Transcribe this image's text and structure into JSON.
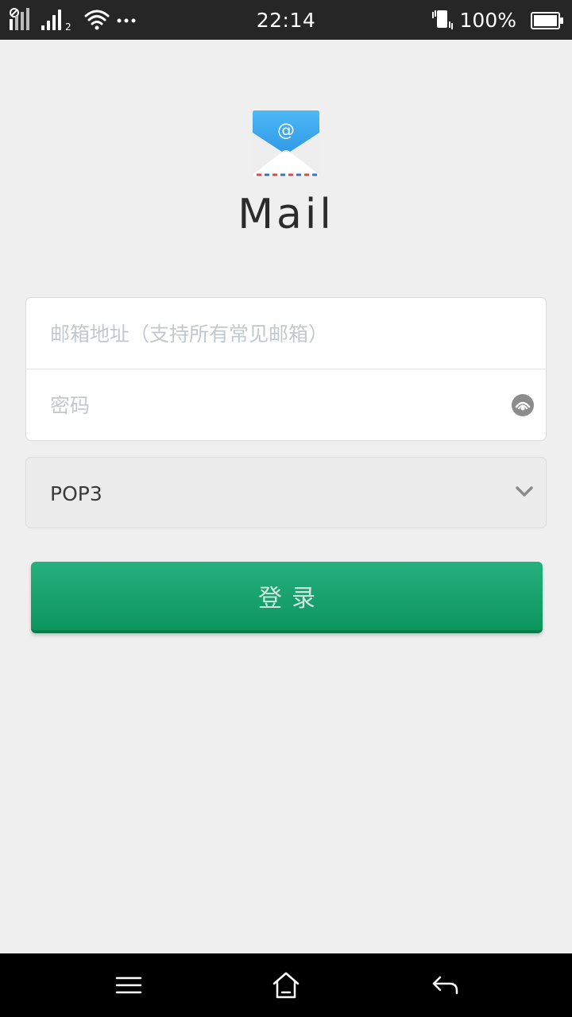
{
  "status_bar": {
    "time": "22:14",
    "battery_percent": "100%",
    "left_icons": [
      "sim1-signal-icon",
      "sim2-signal-icon",
      "wifi-icon",
      "more-notifications-icon"
    ],
    "right_icons": [
      "vibrate-icon",
      "battery-icon"
    ]
  },
  "app": {
    "title": "Mail",
    "logo_icon": "mail-envelope-icon"
  },
  "form": {
    "email_placeholder": "邮箱地址（支持所有常见邮箱）",
    "email_value": "",
    "password_placeholder": "密码",
    "password_value": "",
    "password_toggle_icon": "eye-icon",
    "protocol_selected": "POP3",
    "login_label": "登录"
  },
  "nav_bar": {
    "icons": [
      "menu-icon",
      "home-icon",
      "back-icon"
    ]
  },
  "colors": {
    "accent": "#1ba572",
    "background": "#efefef",
    "status_bar": "#262626",
    "logo_blue": "#3aa8ee"
  }
}
